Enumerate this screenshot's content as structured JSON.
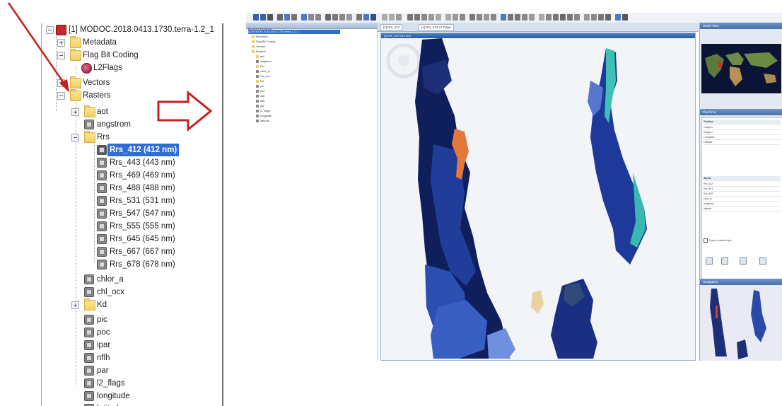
{
  "tree": {
    "product_label": "[1] MODOC.2018.0413.1730.terra-1.2_1",
    "metadata_label": "Metadata",
    "flag_coding_label": "Flag Bit Coding",
    "l2flags_coding_label": "L2Flags",
    "vectors_label": "Vectors",
    "rasters_label": "Rasters",
    "aot_label": "aot",
    "angstrom_label": "angstrom",
    "rrs_folder_label": "Rrs",
    "rrs_bands": [
      "Rrs_412 (412 nm)",
      "Rrs_443 (443 nm)",
      "Rrs_469 (469 nm)",
      "Rrs_488 (488 nm)",
      "Rrs_531 (531 nm)",
      "Rrs_547 (547 nm)",
      "Rrs_555 (555 nm)",
      "Rrs_645 (645 nm)",
      "Rrs_667 (667 nm)",
      "Rrs_678 (678 nm)"
    ],
    "selected_band": "Rrs_412 (412 nm)",
    "other_bands": [
      "chlor_a",
      "chl_ocx"
    ],
    "kd_label": "Kd",
    "lower_bands": [
      "pic",
      "poc",
      "ipar",
      "nflh",
      "par",
      "l2_flags",
      "longitude",
      "latitude"
    ]
  },
  "app": {
    "left_pane_title": "Product Explorer",
    "left_rows": [
      "[1] MODOC.2018.0413.1730.terra-1.2_1",
      "Metadata",
      "Flag Bit Coding",
      "Vectors",
      "Rasters",
      "aot",
      "angstrom",
      "Rrs",
      "chlor_a",
      "chl_ocx",
      "Kd",
      "pic",
      "poc",
      "ipar",
      "nflh",
      "par",
      "l2_flags",
      "longitude",
      "latitude"
    ],
    "doc_tabs": [
      "[1] Rrs_412",
      "[1] Rrs_412 L2 Flags"
    ],
    "image_window_title": "[1] Rrs_412 (412 nm)",
    "world_view_title": "World View",
    "pixel_info_title": "Pixel Info",
    "pixel_info_position_header": "Position",
    "pixel_info_bands_header": "Bands",
    "pixel_info_position_rows": [
      "Image-X",
      "Image-Y",
      "Longitude",
      "Latitude"
    ],
    "pixel_info_band_rows": [
      "Rrs_412",
      "Rrs_443",
      "Rrs_469",
      "chlor_a",
      "longitude",
      "latitude"
    ],
    "snap_checkbox_label": "Snap to selected pin",
    "navigation_title": "Navigation"
  },
  "colors": {
    "selection": "#2f6ed6",
    "arrow_red": "#c42020",
    "ocean_deep": "#0f1f5c",
    "ocean_mid": "#2a4fb0",
    "ocean_light": "#8fb0e8"
  }
}
